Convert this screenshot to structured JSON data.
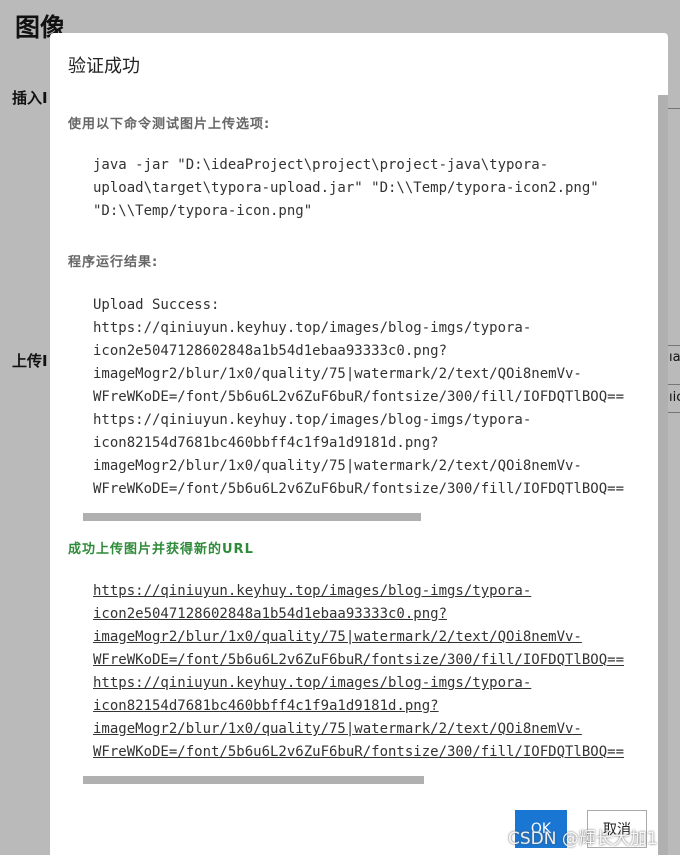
{
  "background": {
    "title": "图像",
    "label_insert": "插入I",
    "label_upload": "上传I",
    "frag1": "ıa",
    "frag2": "ıic"
  },
  "dialog": {
    "title": "验证成功",
    "command_label": "使用以下命令测试图片上传选项:",
    "command_lines": [
      "java -jar \"D:\\ideaProject\\project\\project-java\\typora-",
      "upload\\target\\typora-upload.jar\" \"D:\\\\Temp/typora-icon2.png\"",
      "\"D:\\\\Temp/typora-icon.png\""
    ],
    "result_label": "程序运行结果:",
    "result_lines": [
      "Upload Success:",
      "https://qiniuyun.keyhuy.top/images/blog-imgs/typora-",
      "icon2e5047128602848a1b54d1ebaa93333c0.png?",
      "imageMogr2/blur/1x0/quality/75|watermark/2/text/QOi8nemVv-",
      "WFreWKoDE=/font/5b6u6L2v6ZuF6buR/fontsize/300/fill/IOFDQTlBOQ==",
      "https://qiniuyun.keyhuy.top/images/blog-imgs/typora-",
      "icon82154d7681bc460bbff4c1f9a1d9181d.png?",
      "imageMogr2/blur/1x0/quality/75|watermark/2/text/QOi8nemVv-",
      "WFreWKoDE=/font/5b6u6L2v6ZuF6buR/fontsize/300/fill/IOFDQTlBOQ=="
    ],
    "success_label": "成功上传图片并获得新的URL",
    "url_lines": [
      "https://qiniuyun.keyhuy.top/images/blog-imgs/typora-",
      "icon2e5047128602848a1b54d1ebaa93333c0.png?",
      "imageMogr2/blur/1x0/quality/75|watermark/2/text/QOi8nemVv-",
      "WFreWKoDE=/font/5b6u6L2v6ZuF6buR/fontsize/300/fill/IOFDQTlBOQ==",
      "https://qiniuyun.keyhuy.top/images/blog-imgs/typora-",
      "icon82154d7681bc460bbff4c1f9a1d9181d.png?",
      "imageMogr2/blur/1x0/quality/75|watermark/2/text/QOi8nemVv-",
      "WFreWKoDE=/font/5b6u6L2v6ZuF6buR/fontsize/300/fill/IOFDQTlBOQ=="
    ],
    "ok_label": "OK",
    "cancel_label": "取消",
    "accent_color": "#1976d2",
    "success_color": "#2e8b3a"
  },
  "watermark": "CSDN @輝长大加1"
}
